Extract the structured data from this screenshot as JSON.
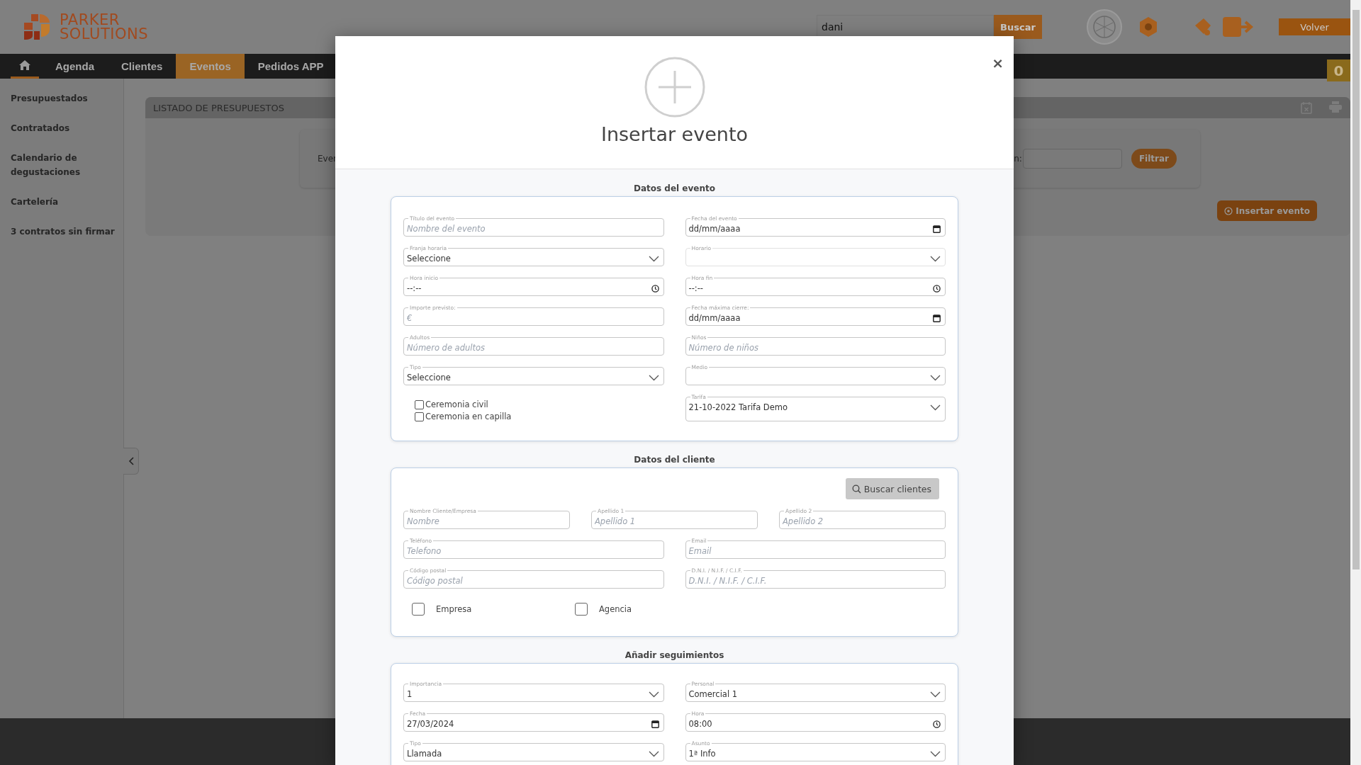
{
  "header": {
    "logo": {
      "line1": "PARKER",
      "line2": "SOLUTIONS"
    },
    "search": {
      "value": "dani"
    },
    "search_button": "Buscar",
    "back_button": "Volver"
  },
  "nav": {
    "items": [
      {
        "kind": "home",
        "selected": false
      },
      {
        "kind": "text",
        "label": "Agenda",
        "selected": false
      },
      {
        "kind": "text",
        "label": "Clientes",
        "selected": false
      },
      {
        "kind": "text",
        "label": "Eventos",
        "selected": true
      },
      {
        "kind": "text",
        "label": "Pedidos APP",
        "selected": false
      }
    ],
    "badge": "0"
  },
  "sidebar": {
    "items": [
      "Presupuestados",
      "Contratados",
      "Calendario de degustaciones",
      "Cartelería",
      "3 contratos sin firmar"
    ]
  },
  "listing": {
    "title": "LISTADO DE PRESUPUESTOS",
    "filter": {
      "left_label": "Ever",
      "right_label": "n:",
      "button": "Filtrar"
    },
    "insert_button": "Insertar evento"
  },
  "modal": {
    "title": "Insertar evento",
    "close": "×",
    "sections": [
      {
        "title": "Datos del evento",
        "rows": [
          {
            "cells": [
              {
                "kind": "text",
                "label": "Título del evento",
                "placeholder": "Nombre del evento",
                "disabled": false
              },
              {
                "kind": "date",
                "label": "Fecha del evento",
                "value": "dd/mm/aaaa",
                "disabled": false
              }
            ]
          },
          {
            "cells": [
              {
                "kind": "select",
                "label": "Franja horaria",
                "value": "Seleccione",
                "disabled": false
              },
              {
                "kind": "select",
                "label": "Horario",
                "disabled": true
              }
            ]
          },
          {
            "cells": [
              {
                "kind": "time",
                "label": "Hora inicio",
                "value": "--:--",
                "disabled": false
              },
              {
                "kind": "time",
                "label": "Hora fin",
                "value": "--:--",
                "disabled": false
              }
            ]
          },
          {
            "cells": [
              {
                "kind": "text",
                "label": "Importe previsto:",
                "placeholder": "€",
                "disabled": false
              },
              {
                "kind": "date",
                "label": "Fecha máxima cierre:",
                "value": "dd/mm/aaaa",
                "disabled": false
              }
            ]
          },
          {
            "cells": [
              {
                "kind": "text",
                "label": "Adultos",
                "placeholder": "Número de adultos",
                "disabled": false
              },
              {
                "kind": "text",
                "label": "Niños",
                "placeholder": "Número de niños",
                "disabled": false
              }
            ]
          },
          {
            "cells": [
              {
                "kind": "select",
                "label": "Tipo",
                "value": "Seleccione",
                "disabled": false
              },
              {
                "kind": "select",
                "label": "Medio",
                "disabled": false
              }
            ]
          },
          {
            "cells": [
              {
                "kind": "checks",
                "items": [
                  {
                    "label": "Ceremonia civil",
                    "checked": false
                  },
                  {
                    "label": "Ceremonia en capilla",
                    "checked": false
                  }
                ]
              },
              {
                "kind": "select",
                "label": "Tarifa",
                "value": "21-10-2022 Tarifa Demo",
                "disabled": false
              }
            ]
          }
        ]
      },
      {
        "title": "Datos del cliente",
        "rows": [
          {
            "cells": [
              {
                "kind": "button",
                "label": "Buscar clientes"
              }
            ]
          },
          {
            "cells": [
              {
                "kind": "text",
                "label": "Nombre Cliente/Empresa",
                "placeholder": "Nombre",
                "disabled": false
              },
              {
                "kind": "text",
                "label": "Apellido 1",
                "placeholder": "Apellido 1",
                "disabled": false
              },
              {
                "kind": "text",
                "label": "Apellido 2",
                "placeholder": "Apellido 2",
                "disabled": false
              }
            ]
          },
          {
            "cells": [
              {
                "kind": "text",
                "label": "Teléfono",
                "placeholder": "Telefono",
                "disabled": false
              },
              {
                "kind": "text",
                "label": "Email",
                "placeholder": "Email",
                "disabled": false
              }
            ]
          },
          {
            "cells": [
              {
                "kind": "text",
                "label": "Código postal",
                "placeholder": "Código postal",
                "disabled": false
              },
              {
                "kind": "text",
                "label": "D.N.I. / N.I.F. / C.I.F.",
                "placeholder": "D.N.I. / N.I.F. / C.I.F.",
                "disabled": false
              }
            ]
          },
          {
            "cells": [
              {
                "kind": "check",
                "label": "Empresa",
                "checked": false
              },
              {
                "kind": "check",
                "label": "Agencia",
                "checked": false
              }
            ]
          }
        ]
      },
      {
        "title": "Añadir seguimientos",
        "rows": [
          {
            "cells": [
              {
                "kind": "select",
                "label": "Importancia",
                "value": "1",
                "disabled": false
              },
              {
                "kind": "select",
                "label": "Personal",
                "value": "Comercial 1",
                "disabled": false
              }
            ]
          },
          {
            "cells": [
              {
                "kind": "date",
                "label": "Fecha",
                "value": "27/03/2024",
                "disabled": false
              },
              {
                "kind": "time",
                "label": "Hora",
                "value": "08:00",
                "disabled": false
              }
            ]
          },
          {
            "cells": [
              {
                "kind": "select",
                "label": "Tipo",
                "value": "Llamada",
                "disabled": false
              },
              {
                "kind": "select",
                "label": "Asunto",
                "value": "1ª Info",
                "disabled": false
              }
            ]
          }
        ]
      }
    ]
  }
}
